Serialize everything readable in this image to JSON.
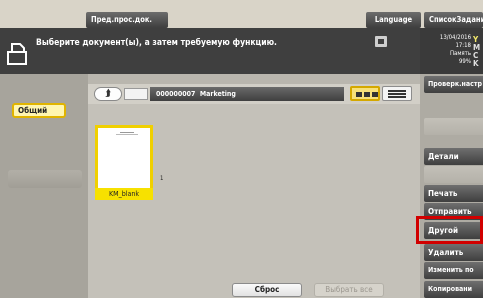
{
  "topbar": {
    "preview_label": "Пред.прос.док.",
    "language_label": "Language",
    "joblist_label": "СписокЗадани"
  },
  "instruction": {
    "text": "Выберите документ(ы), а затем требуемую функцию."
  },
  "status": {
    "date": "13/04/2016",
    "time": "17:18",
    "memory_label": "Память",
    "memory_pct": "99%",
    "toner": [
      "Y",
      "M",
      "C",
      "K"
    ]
  },
  "sidebar": {
    "tabs": [
      "Общий"
    ]
  },
  "box": {
    "id": "000000007",
    "name": "Marketing",
    "up_label": "⮭"
  },
  "files": [
    {
      "name": "KM_blank",
      "pages": "1"
    }
  ],
  "footer": {
    "reset_label": "Сброс",
    "select_all_label": "Выбрать все"
  },
  "right_panel": {
    "check_settings": "Проверк.настр",
    "details": "Детали",
    "print": "Печать",
    "send": "Отправить",
    "other": "Другой",
    "delete": "Удалить",
    "change": "Изменить по",
    "copy": "Копировани"
  },
  "colors": {
    "accent_yellow": "#f7e100",
    "highlight_red": "#d10000",
    "button_dark": "#3f3f3f"
  }
}
